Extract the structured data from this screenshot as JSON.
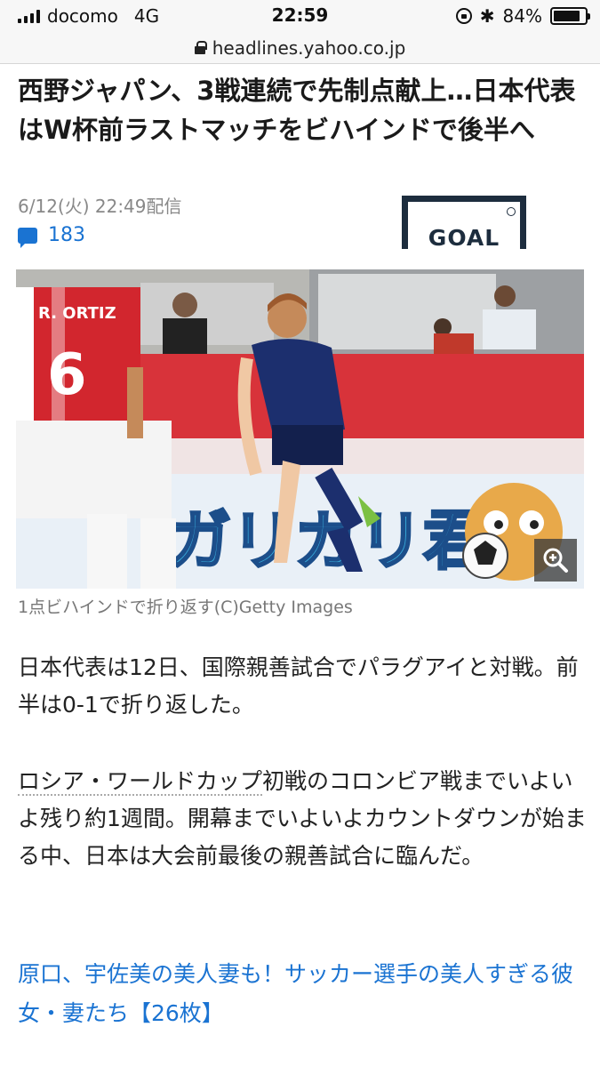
{
  "status_bar": {
    "carrier": "docomo",
    "network": "4G",
    "time": "22:59",
    "battery": "84%",
    "battery_level": 0.84
  },
  "url_bar": {
    "url": "headlines.yahoo.co.jp"
  },
  "article": {
    "headline": "西野ジャパン、3戦連続で先制点献上…日本代表はW杯前ラストマッチをビハインドで後半へ",
    "date": "6/12(火) 22:49配信",
    "comment_count": "183",
    "source_logo": "GOAL",
    "image_caption": "1点ビハインドで折り返す(C)Getty Images",
    "paragraph1": "日本代表は12日、国際親善試合でパラグアイと対戦。前半は0-1で折り返した。",
    "paragraph2_link": "ロシア・ワールドカップ",
    "paragraph2_rest": "初戦のコロンビア戦までいよいよ残り約1週間。開幕までいよいよカウントダウンが始まる中、日本は大会前最後の親善試合に臨んだ。",
    "related_link": "原口、宇佐美の美人妻も！サッカー選手の美人すぎる彼女・妻たち【26枚】"
  },
  "photo": {
    "jersey_name": "R. ORTIZ",
    "jersey_number": "6",
    "banner_text": "ガリガリ君"
  },
  "colors": {
    "link": "#1a73d2",
    "logo": "#1d2d3e"
  }
}
